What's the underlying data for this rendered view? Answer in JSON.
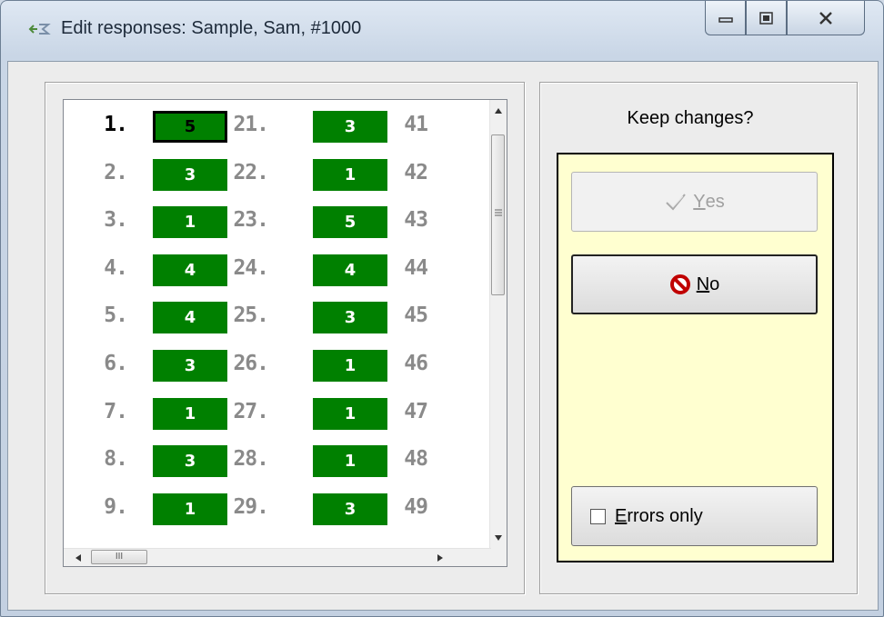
{
  "window": {
    "title": "Edit responses: Sample, Sam, #1000",
    "controls": [
      "minimize",
      "maximize",
      "close"
    ]
  },
  "responses": {
    "columns": [
      [
        {
          "n": "1.",
          "v": "5",
          "selected": true
        },
        {
          "n": "2.",
          "v": "3"
        },
        {
          "n": "3.",
          "v": "1"
        },
        {
          "n": "4.",
          "v": "4"
        },
        {
          "n": "5.",
          "v": "4"
        },
        {
          "n": "6.",
          "v": "3"
        },
        {
          "n": "7.",
          "v": "1"
        },
        {
          "n": "8.",
          "v": "3"
        },
        {
          "n": "9.",
          "v": "1"
        }
      ],
      [
        {
          "n": "21.",
          "v": "3"
        },
        {
          "n": "22.",
          "v": "1"
        },
        {
          "n": "23.",
          "v": "5"
        },
        {
          "n": "24.",
          "v": "4"
        },
        {
          "n": "25.",
          "v": "3"
        },
        {
          "n": "26.",
          "v": "1"
        },
        {
          "n": "27.",
          "v": "1"
        },
        {
          "n": "28.",
          "v": "1"
        },
        {
          "n": "29.",
          "v": "3"
        }
      ],
      [
        {
          "n": "41"
        },
        {
          "n": "42"
        },
        {
          "n": "43"
        },
        {
          "n": "44"
        },
        {
          "n": "45"
        },
        {
          "n": "46"
        },
        {
          "n": "47"
        },
        {
          "n": "48"
        },
        {
          "n": "49"
        }
      ]
    ],
    "colors": {
      "cell": "#008000",
      "number": "#8a8a8a",
      "selected_number": "#000000"
    }
  },
  "panel": {
    "prompt": "Keep changes?",
    "yes": {
      "icon": "checkmark-icon",
      "accel": "Y",
      "rest": "es",
      "enabled": false
    },
    "no": {
      "icon": "no-entry-icon",
      "accel": "N",
      "rest": "o",
      "enabled": true
    },
    "errors_only": {
      "accel": "E",
      "rest": "rrors only",
      "checked": false
    },
    "background": "#ffffd0"
  },
  "scrollbar": {
    "grip": "III"
  }
}
